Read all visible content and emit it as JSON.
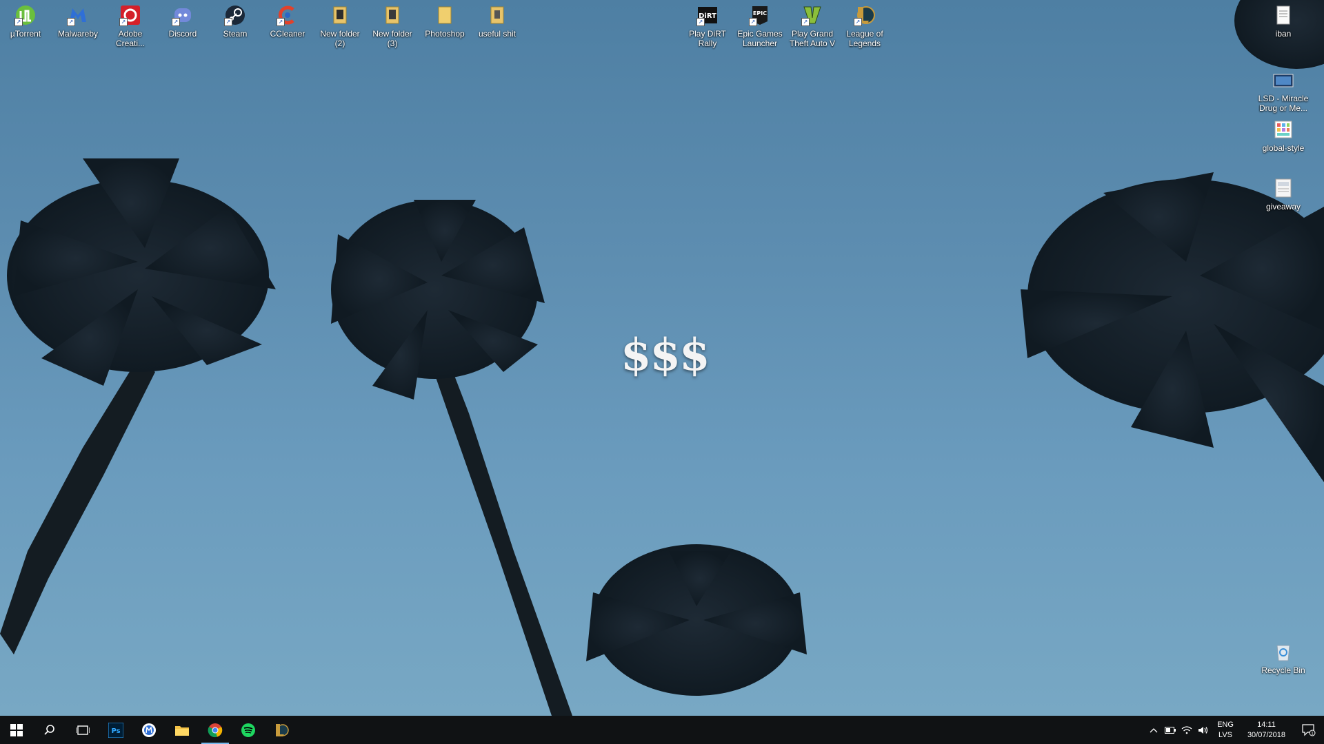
{
  "desktop_icons_top": [
    {
      "label": "µTorrent",
      "icon": "utorrent-icon",
      "color": "#6abf3d"
    },
    {
      "label": "Malwareby",
      "icon": "malwarebytes-icon",
      "color": "#2f6fd6"
    },
    {
      "label": "Adobe Creati...",
      "icon": "adobe-cc-icon",
      "color": "#d4202a"
    },
    {
      "label": "Discord",
      "icon": "discord-icon",
      "color": "#7289da"
    },
    {
      "label": "Steam",
      "icon": "steam-icon",
      "color": "#1b2838"
    },
    {
      "label": "CCleaner",
      "icon": "ccleaner-icon",
      "color": "#e2412a"
    },
    {
      "label": "New folder (2)",
      "icon": "folder-icon",
      "color": "#e8c46a"
    },
    {
      "label": "New folder (3)",
      "icon": "folder-icon",
      "color": "#e8c46a"
    },
    {
      "label": "Photoshop",
      "icon": "folder-icon",
      "color": "#f0cf6e"
    },
    {
      "label": "useful shit",
      "icon": "folder-icon",
      "color": "#e8c46a"
    }
  ],
  "desktop_icons_games": [
    {
      "label": "Play DiRT Rally",
      "icon": "dirt-rally-icon",
      "color": "#111111"
    },
    {
      "label": "Epic Games Launcher",
      "icon": "epic-games-icon",
      "color": "#1a1a1a"
    },
    {
      "label": "Play Grand Theft Auto V",
      "icon": "gta-v-icon",
      "color": "#8bbf3b"
    },
    {
      "label": "League of Legends",
      "icon": "league-icon",
      "color": "#c89b3c"
    }
  ],
  "desktop_icons_right": [
    {
      "label": "iban",
      "icon": "text-file-icon"
    },
    {
      "label": "LSD - Miracle Drug or Me...",
      "icon": "video-file-icon"
    },
    {
      "label": "global-style",
      "icon": "image-file-icon"
    },
    {
      "label": "giveaway",
      "icon": "document-file-icon"
    }
  ],
  "recycle_bin": {
    "label": "Recycle Bin",
    "icon": "recycle-bin-icon"
  },
  "wallpaper": {
    "text": "$$$"
  },
  "taskbar": {
    "buttons": [
      {
        "name": "start-button",
        "icon": "windows-icon"
      },
      {
        "name": "search-button",
        "icon": "search-icon"
      },
      {
        "name": "task-view-button",
        "icon": "task-view-icon"
      },
      {
        "name": "photoshop-taskbar-button",
        "icon": "photoshop-icon",
        "text": "Ps"
      },
      {
        "name": "malwarebytes-taskbar-button",
        "icon": "malwarebytes-icon"
      },
      {
        "name": "file-explorer-taskbar-button",
        "icon": "folder-icon"
      },
      {
        "name": "chrome-taskbar-button",
        "icon": "chrome-icon"
      },
      {
        "name": "spotify-taskbar-button",
        "icon": "spotify-icon"
      },
      {
        "name": "league-taskbar-button",
        "icon": "league-icon"
      }
    ],
    "tray": {
      "language": "ENG",
      "layout": "LVS",
      "time": "14:11",
      "date": "30/07/2018",
      "notification_count": "1"
    }
  }
}
